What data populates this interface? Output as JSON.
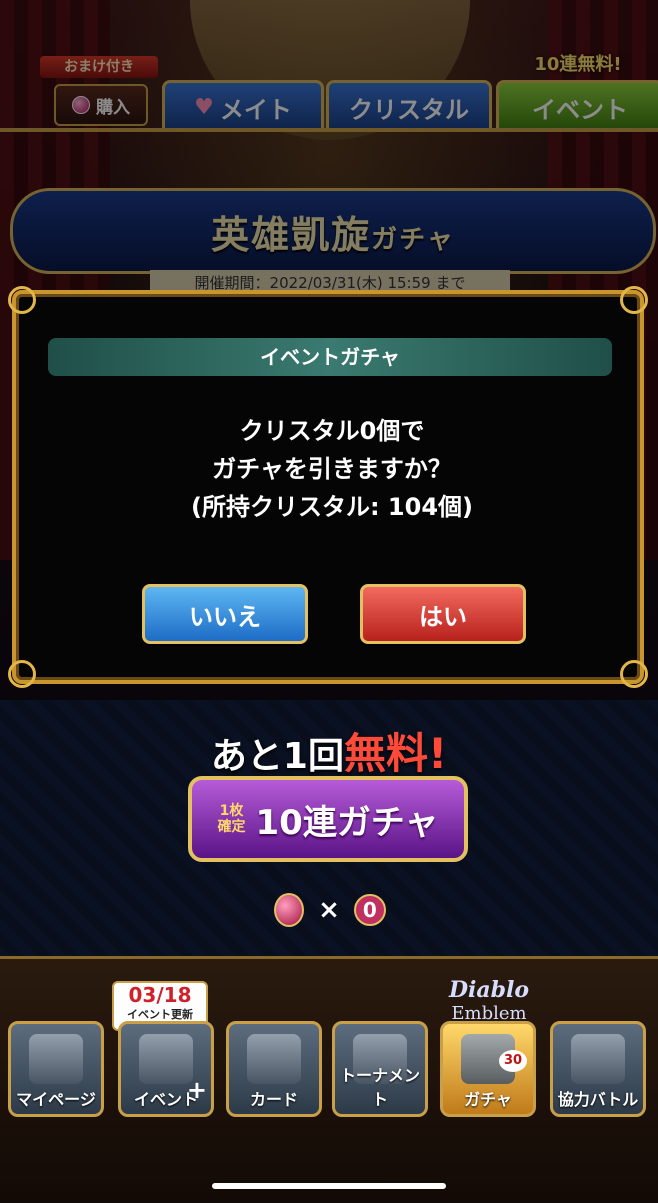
{
  "top_bar": {
    "bonus_label": "おまけ付き",
    "buy_label": "購入",
    "free_label": "10連無料!",
    "tabs": [
      {
        "label": "メイト"
      },
      {
        "label": "クリスタル"
      },
      {
        "label": "イベント"
      }
    ]
  },
  "banner": {
    "title": "英雄凱旋",
    "title_suffix": "ガチャ",
    "period": "開催期間：2022/03/31(木) 15:59 まで"
  },
  "dialog": {
    "title": "イベントガチャ",
    "message_lines": [
      "クリスタル0個で",
      "ガチャを引きますか？",
      "(所持クリスタル: 104個)"
    ],
    "no_label": "いいえ",
    "yes_label": "はい"
  },
  "free_gacha": {
    "prefix": "あと1回",
    "highlight": "無料!",
    "sub_line1": "1枚",
    "sub_line2": "確定",
    "button_label": "10連ガチャ",
    "cost_symbol": "×",
    "cost_value": "0"
  },
  "nav": {
    "event_badge_date": "03/18",
    "event_badge_text": "イベント更新",
    "logo_line1": "Diablo",
    "logo_line2": "Emblem",
    "gacha_count": "30",
    "items": [
      {
        "label": "マイページ"
      },
      {
        "label": "イベント"
      },
      {
        "label": "カード"
      },
      {
        "label": "トーナメント"
      },
      {
        "label": "ガチャ"
      },
      {
        "label": "協力バトル"
      }
    ]
  },
  "colors": {
    "no_button": "#1d6cc6",
    "yes_button": "#b8211c",
    "gold_border": "#c9962e",
    "dialog_header": "#3a7a70"
  }
}
